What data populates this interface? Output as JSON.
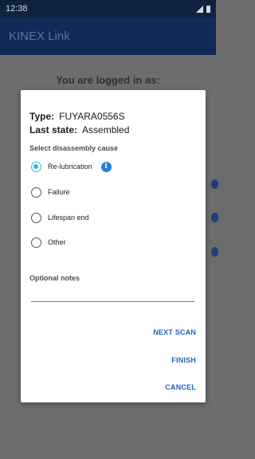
{
  "status_bar": {
    "time": "12:38"
  },
  "app_bar": {
    "title": "KINEX Link"
  },
  "background": {
    "logged_in_text": "You are logged in as:"
  },
  "dialog": {
    "type_key": "Type:",
    "type_value": "FUYARA0556S",
    "last_state_key": "Last state:",
    "last_state_value": "Assembled",
    "section_label": "Select disassembly cause",
    "options": [
      {
        "label": "Re-lubrication",
        "checked": true
      },
      {
        "label": "Failure",
        "checked": false
      },
      {
        "label": "Lifespan end",
        "checked": false
      },
      {
        "label": "Other",
        "checked": false
      }
    ],
    "info_icon_glyph": "i",
    "notes_label": "Optional notes",
    "notes_value": "",
    "next_scan_label": "NEXT SCAN",
    "finish_label": "FINISH",
    "cancel_label": "CANCEL"
  },
  "colors": {
    "app_bar": "#0f2a57",
    "accent": "#2eb8d8",
    "button_text": "#1e63b8",
    "info_icon": "#2680d9"
  }
}
